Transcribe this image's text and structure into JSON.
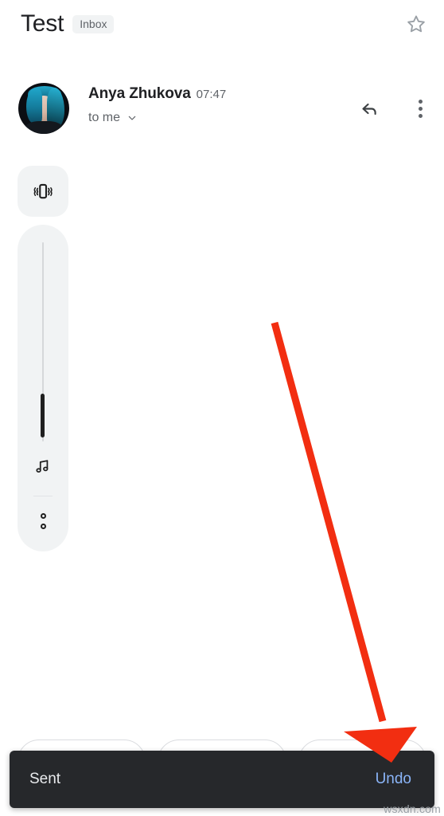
{
  "header": {
    "subject": "Test",
    "label_chip": "Inbox",
    "star_icon": "star-outline-icon"
  },
  "message": {
    "sender_name": "Anya Zhukova",
    "time": "07:47",
    "recipient": "to me",
    "recipient_expand_icon": "chevron-down-icon",
    "reply_icon": "reply-arrow-icon",
    "overflow_icon": "more-vert-icon",
    "avatar": "sender-avatar-photo"
  },
  "volume_panel": {
    "vibrate_icon": "phone-vibrate-icon",
    "slider": {
      "value_percent": 22,
      "orientation": "vertical"
    },
    "music_icon": "music-note-icon",
    "more_icon": "more-options-dots-icon"
  },
  "smart_replies": {
    "chips": [
      "",
      "",
      ""
    ]
  },
  "snackbar": {
    "message": "Sent",
    "action_label": "Undo",
    "background_color": "#26282b",
    "action_color": "#8ab4f8"
  },
  "annotation": {
    "arrow_color": "#f22e11",
    "points_to": "Undo"
  },
  "watermark": {
    "text": "wsxdn.com"
  }
}
